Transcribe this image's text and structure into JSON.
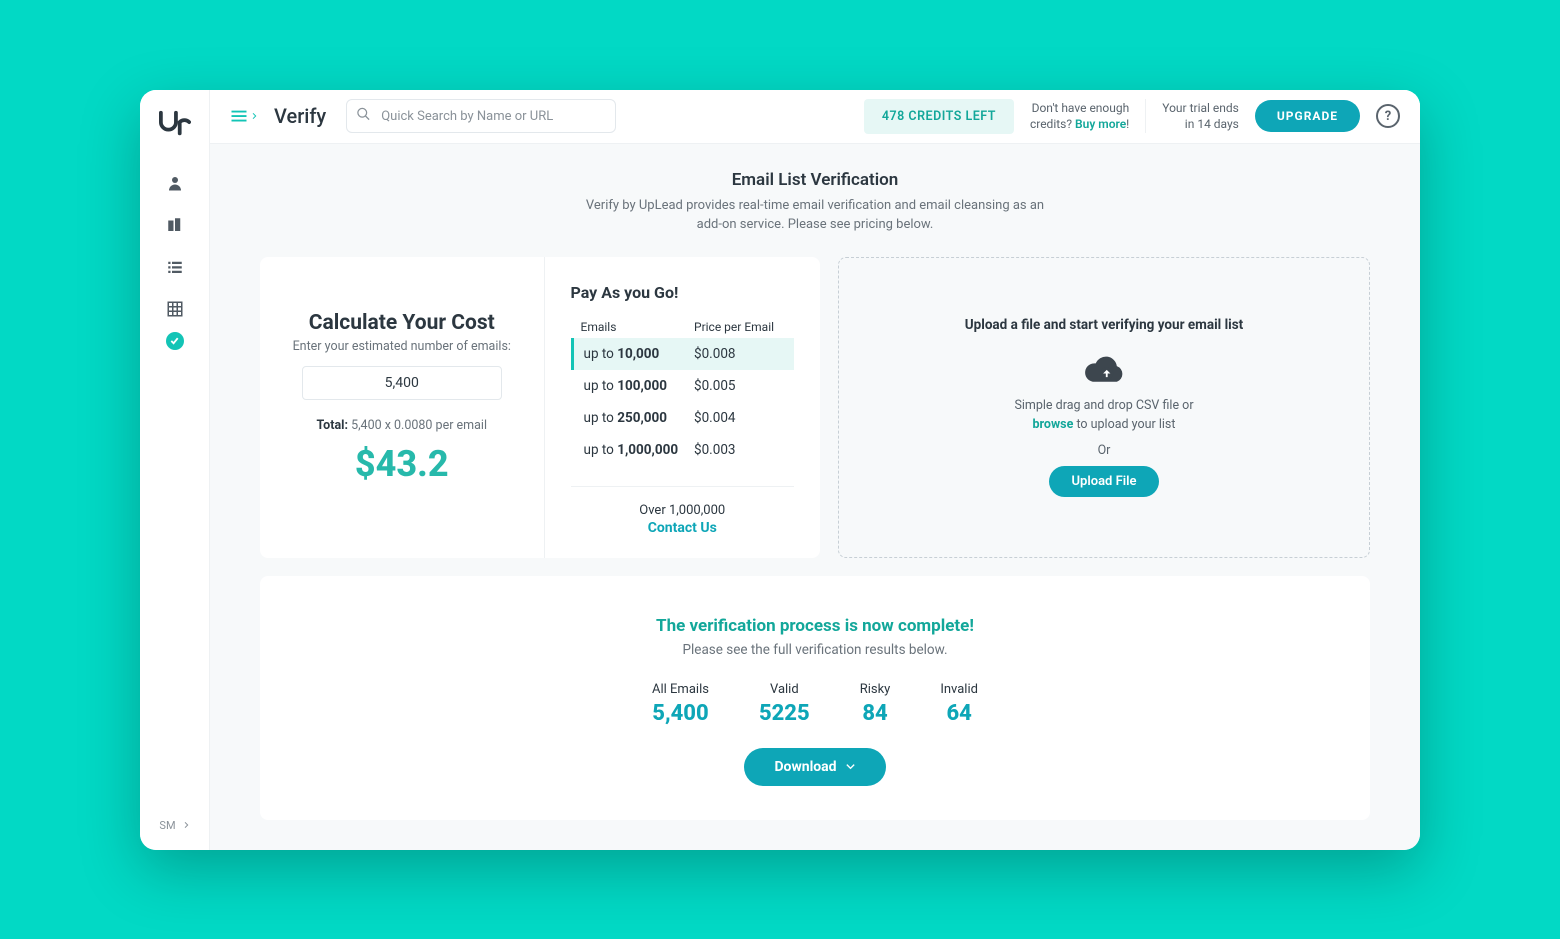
{
  "header": {
    "page_title": "Verify",
    "search_placeholder": "Quick Search by Name or URL",
    "credits_left": "478 CREDITS LEFT",
    "credits_msg_line1": "Don't have enough",
    "credits_msg_line2": "credits? ",
    "credits_buy_more": "Buy more",
    "trial_line1": "Your trial ends",
    "trial_line2": "in 14 days",
    "upgrade": "UPGRADE"
  },
  "hero": {
    "title": "Email List Verification",
    "subtitle": "Verify by UpLead provides real-time email verification and email cleansing as an add-on service. Please see pricing below."
  },
  "calc": {
    "title": "Calculate Your Cost",
    "subtitle": "Enter your estimated number of emails:",
    "input_value": "5,400",
    "total_label": "Total:",
    "total_detail": " 5,400 x 0.0080 per email",
    "price": "$43.2"
  },
  "pricing": {
    "title": "Pay As you Go!",
    "col_emails": "Emails",
    "col_price": "Price per Email",
    "tiers": [
      {
        "upto_prefix": "up to ",
        "upto": "10,000",
        "price": "$0.008",
        "active": true
      },
      {
        "upto_prefix": "up to ",
        "upto": "100,000",
        "price": "$0.005",
        "active": false
      },
      {
        "upto_prefix": "up to ",
        "upto": "250,000",
        "price": "$0.004",
        "active": false
      },
      {
        "upto_prefix": "up to ",
        "upto": "1,000,000",
        "price": "$0.003",
        "active": false
      }
    ],
    "over_label": "Over 1,000,000",
    "contact": "Contact Us"
  },
  "upload": {
    "title": "Upload a file and start verifying your email list",
    "drag_text_1": "Simple drag and drop CSV file or",
    "browse": "browse",
    "drag_text_2": " to upload your list",
    "or": "Or",
    "button": "Upload File"
  },
  "results": {
    "title": "The verification process is now complete!",
    "subtitle": "Please see the full verification results below.",
    "stats": [
      {
        "label": "All Emails",
        "value": "5,400"
      },
      {
        "label": "Valid",
        "value": "5225"
      },
      {
        "label": "Risky",
        "value": "84"
      },
      {
        "label": "Invalid",
        "value": "64"
      }
    ],
    "download": "Download"
  },
  "left_rail": {
    "bottom_initials": "SM"
  }
}
